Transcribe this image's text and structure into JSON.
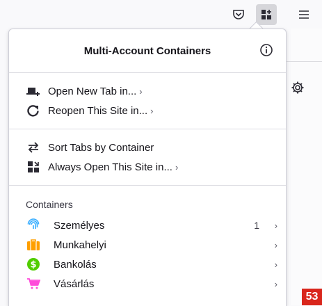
{
  "toolbar": {
    "icons": [
      "pocket-icon",
      "containers-icon",
      "menu-icon"
    ]
  },
  "panel": {
    "title": "Multi-Account Containers",
    "actions": [
      {
        "label": "Open New Tab in...",
        "icon": "new-tab-icon"
      },
      {
        "label": "Reopen This Site in...",
        "icon": "reopen-icon"
      },
      {
        "label": "Sort Tabs by Container",
        "icon": "sort-icon"
      },
      {
        "label": "Always Open This Site in...",
        "icon": "always-open-icon"
      }
    ],
    "containers_label": "Containers",
    "containers": [
      {
        "name": "Személyes",
        "count": "1",
        "icon": "fingerprint-icon",
        "color": "#37adff"
      },
      {
        "name": "Munkahelyi",
        "count": "",
        "icon": "briefcase-icon",
        "color": "#ff9f00"
      },
      {
        "name": "Bankolás",
        "count": "",
        "icon": "dollar-icon",
        "color": "#51cd00"
      },
      {
        "name": "Vásárlás",
        "count": "",
        "icon": "cart-icon",
        "color": "#ff4bda"
      }
    ]
  },
  "page_badge": "53"
}
